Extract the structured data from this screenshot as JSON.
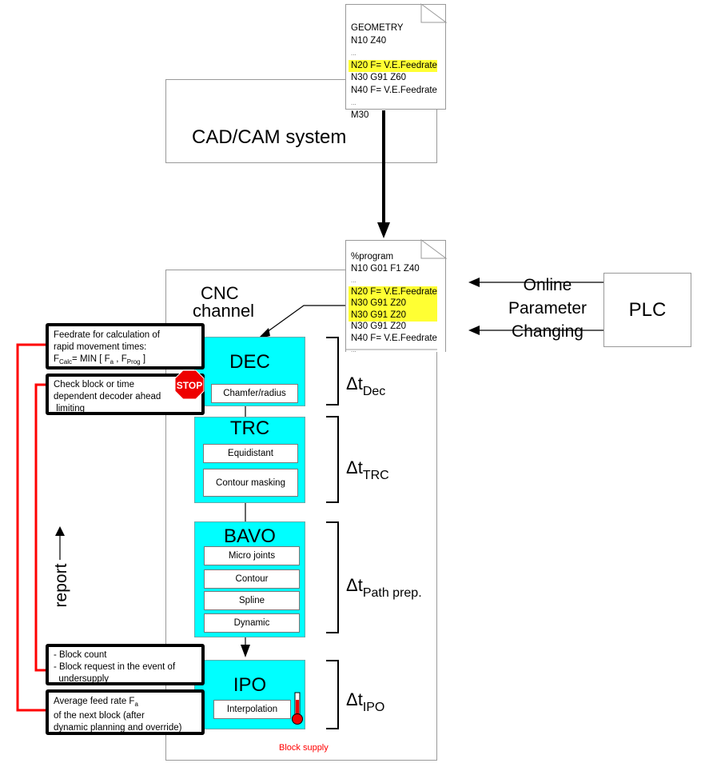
{
  "cadcam": {
    "label": "CAD/CAM system"
  },
  "geometry_doc": {
    "lines": [
      {
        "text": "GEOMETRY",
        "highlight": false
      },
      {
        "text": "N10 Z40",
        "highlight": false
      },
      {
        "text": "...",
        "highlight": false
      },
      {
        "text": "N20 F= V.E.Feedrate",
        "highlight": true
      },
      {
        "text": "N30 G91 Z60",
        "highlight": false
      },
      {
        "text": "N40 F= V.E.Feedrate",
        "highlight": false
      },
      {
        "text": "...",
        "highlight": false
      },
      {
        "text": "M30",
        "highlight": false
      }
    ]
  },
  "program_doc": {
    "lines": [
      {
        "text": "%program",
        "highlight": false
      },
      {
        "text": "N10 G01 F1 Z40",
        "highlight": false
      },
      {
        "text": "...",
        "highlight": false
      },
      {
        "text": "N20 F= V.E.Feedrate",
        "highlight": true
      },
      {
        "text": "N30 G91 Z20",
        "highlight": true
      },
      {
        "text": "N30 G91 Z20",
        "highlight": true
      },
      {
        "text": "N30 G91 Z20",
        "highlight": false
      },
      {
        "text": "N40 F= V.E.Feedrate",
        "highlight": false
      },
      {
        "text": "...",
        "highlight": false
      }
    ]
  },
  "plc": {
    "label": "PLC"
  },
  "online_param": {
    "line1": "Online",
    "line2": "Parameter",
    "line3": "Changing"
  },
  "cnc": {
    "line1": "CNC",
    "line2": "channel"
  },
  "stages": {
    "dec": {
      "title": "DEC",
      "subs": [
        "Chamfer/radius"
      ],
      "dt_main": "Δt",
      "dt_sub": "Dec"
    },
    "trc": {
      "title": "TRC",
      "subs": [
        "Equidistant",
        "Contour masking"
      ],
      "dt_main": "Δt",
      "dt_sub": "TRC"
    },
    "bavo": {
      "title": "BAVO",
      "subs": [
        "Micro joints",
        "Contour",
        "Spline",
        "Dynamic"
      ],
      "dt_main": "Δt",
      "dt_sub": "Path prep."
    },
    "ipo": {
      "title": "IPO",
      "subs": [
        "Interpolation"
      ],
      "dt_main": "Δt",
      "dt_sub": "IPO"
    }
  },
  "notes": {
    "feedrate": {
      "line1": "Feedrate for calculation of",
      "line2": "rapid movement times:",
      "f": "F",
      "calc": "Calc",
      "mid": "= MIN [ F",
      "a": "a",
      "comma": " , F",
      "prog": "Prog",
      "end": " ]"
    },
    "check": {
      "line1": "Check block or time",
      "line2": "dependent decoder ahead",
      "line3": " limiting"
    },
    "block": {
      "line1": "- Block count",
      "line2": "- Block request in the event of",
      "line3": "  undersupply"
    },
    "avg": {
      "line1a": "Average feed rate F",
      "line1sub": "a",
      "line2": "of the next block (after",
      "line3": "dynamic planning and override)"
    }
  },
  "stop_sign": {
    "label": "STOP"
  },
  "report": {
    "label": "report"
  },
  "block_supply": {
    "label": "Block supply"
  },
  "colors": {
    "stage": "#00ffff",
    "highlight": "#ffff33",
    "feedback": "#ff0000",
    "stop": "#ee0000"
  }
}
